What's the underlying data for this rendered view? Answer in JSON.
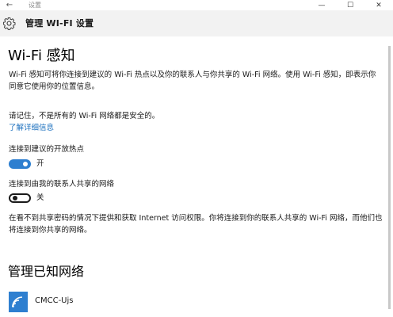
{
  "window": {
    "app_title": "设置",
    "back_glyph": "←",
    "minimize_glyph": "—",
    "maximize_glyph": "☐",
    "close_glyph": "✕"
  },
  "header": {
    "title": "管理 WI-FI 设置",
    "icon": "gear-icon"
  },
  "wifi_sense": {
    "title": "Wi-Fi 感知",
    "description": "Wi-Fi 感知可将你连接到建议的 Wi-Fi 热点以及你的联系人与你共享的 Wi-Fi 网络。使用 Wi-Fi 感知，即表示你同意它使用你的位置信息。",
    "warning": "请记住，不是所有的 Wi-Fi 网络都是安全的。",
    "learn_more": "了解详细信息",
    "hotspot_label": "连接到建议的开放热点",
    "hotspot_state": "开",
    "contacts_label": "连接到由我的联系人共享的网络",
    "contacts_state": "关",
    "note": "在看不到共享密码的情况下提供和获取 Internet 访问权限。你将连接到你的联系人共享的 Wi-Fi 网络，而他们也将连接到你共享的网络。"
  },
  "known_networks": {
    "title": "管理已知网络",
    "items": [
      {
        "name": "CMCC-Ujs",
        "icon": "wifi-icon"
      }
    ]
  },
  "colors": {
    "accent": "#2e7fd0",
    "link": "#1a6fbe",
    "header_bg": "#f2f2f2"
  }
}
